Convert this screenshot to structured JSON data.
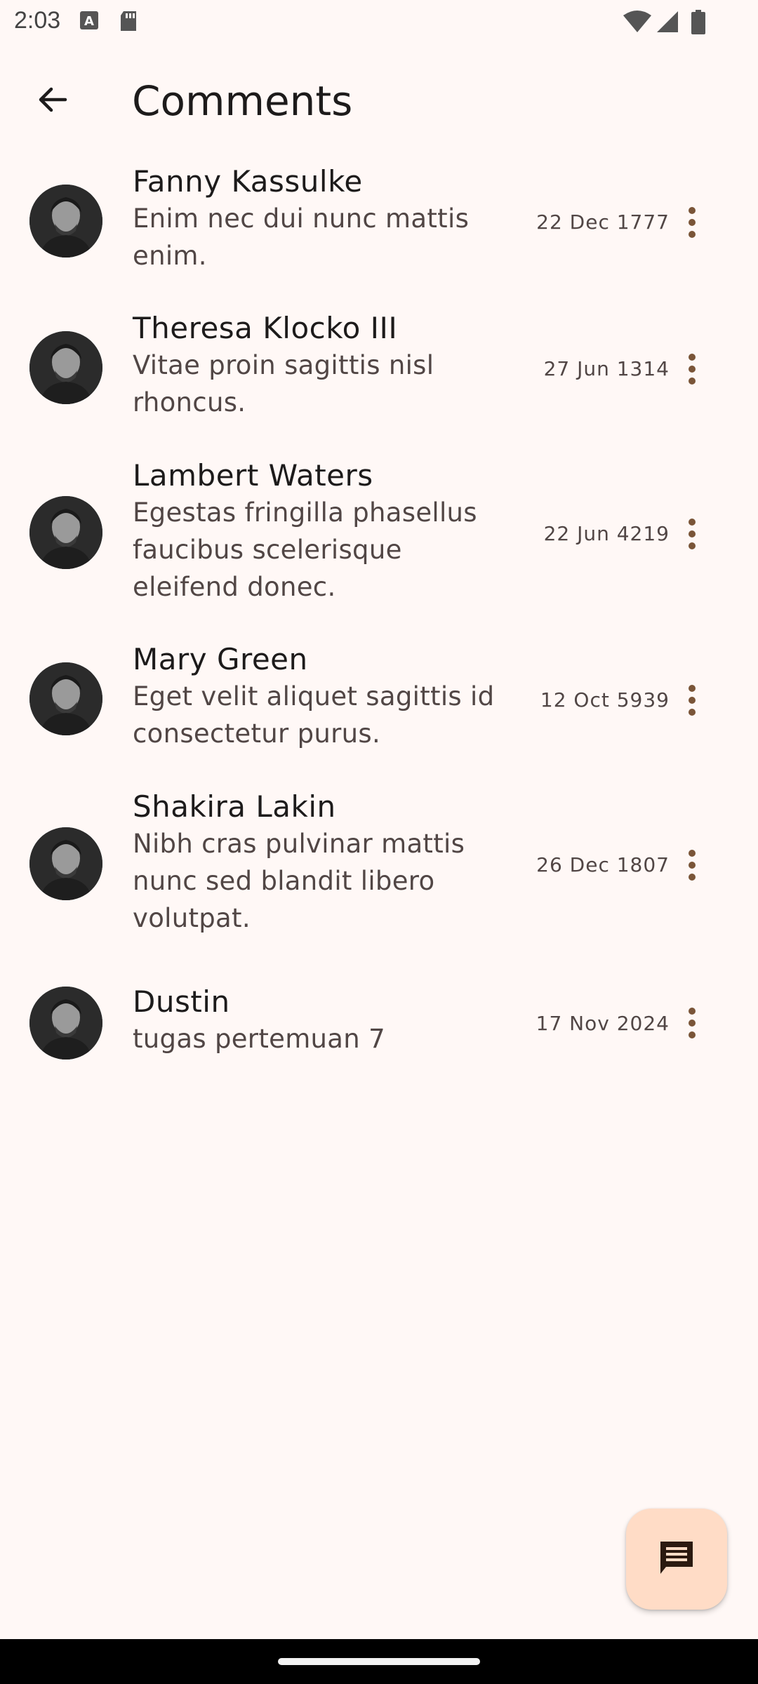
{
  "status_bar": {
    "time": "2:03"
  },
  "app_bar": {
    "title": "Comments",
    "back_icon": "arrow-back-icon"
  },
  "comments": [
    {
      "name": "Fanny Kassulke",
      "lines": [
        "Enim nec dui nunc mattis",
        "enim."
      ],
      "date": "22 Dec 1777"
    },
    {
      "name": "Theresa Klocko III",
      "lines": [
        "Vitae proin sagittis nisl",
        "rhoncus."
      ],
      "date": "27 Jun 1314"
    },
    {
      "name": "Lambert Waters",
      "lines": [
        "Egestas fringilla phasellus",
        "faucibus scelerisque",
        "eleifend donec."
      ],
      "date": "22 Jun 4219"
    },
    {
      "name": "Mary Green",
      "lines": [
        "Eget velit aliquet sagittis id",
        "consectetur purus."
      ],
      "date": "12 Oct 5939"
    },
    {
      "name": "Shakira Lakin",
      "lines": [
        "Nibh cras pulvinar mattis",
        "nunc sed blandit libero",
        "volutpat."
      ],
      "date": "26 Dec 1807"
    },
    {
      "name": "Dustin",
      "lines": [
        "tugas pertemuan 7"
      ],
      "date": "17 Nov 2024"
    }
  ],
  "fab": {
    "icon": "comment-icon"
  },
  "colors": {
    "background": "#fff8f6",
    "fab": "#ffdcc6",
    "accent": "#7a5538"
  }
}
